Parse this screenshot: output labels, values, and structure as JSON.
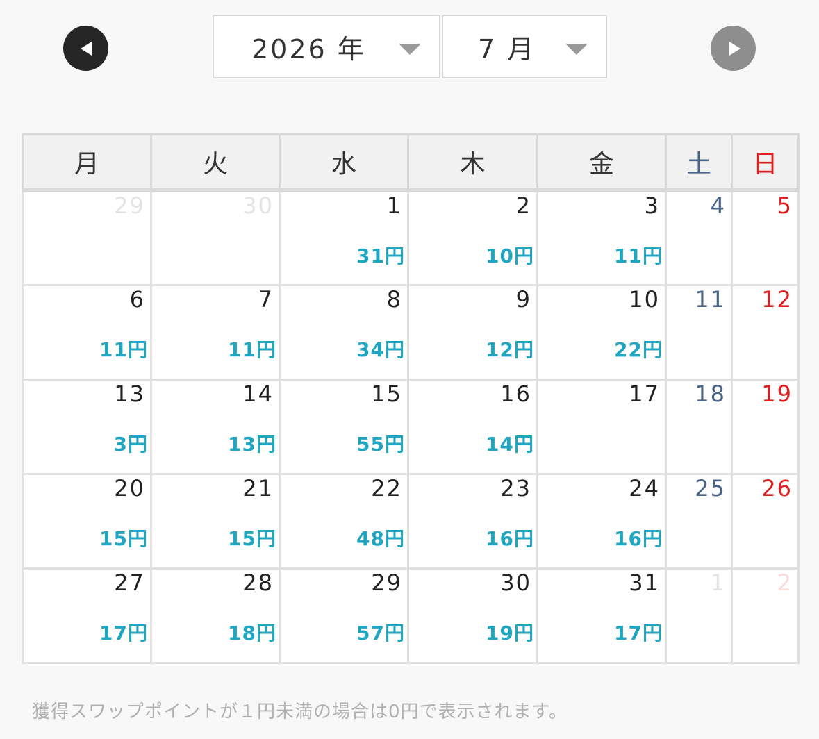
{
  "nav": {
    "prev_icon": "triangle-left-icon",
    "next_icon": "triangle-right-icon"
  },
  "year_select": {
    "value": "2026 年"
  },
  "month_select": {
    "value": "7 月"
  },
  "weekdays": [
    "月",
    "火",
    "水",
    "木",
    "金",
    "土",
    "日"
  ],
  "weeks": [
    [
      {
        "day": "29",
        "amount": "",
        "kind": "other"
      },
      {
        "day": "30",
        "amount": "",
        "kind": "other"
      },
      {
        "day": "1",
        "amount": "31円",
        "kind": "weekday"
      },
      {
        "day": "2",
        "amount": "10円",
        "kind": "weekday"
      },
      {
        "day": "3",
        "amount": "11円",
        "kind": "weekday"
      },
      {
        "day": "4",
        "amount": "",
        "kind": "sat"
      },
      {
        "day": "5",
        "amount": "",
        "kind": "sun"
      }
    ],
    [
      {
        "day": "6",
        "amount": "11円",
        "kind": "weekday"
      },
      {
        "day": "7",
        "amount": "11円",
        "kind": "weekday"
      },
      {
        "day": "8",
        "amount": "34円",
        "kind": "weekday"
      },
      {
        "day": "9",
        "amount": "12円",
        "kind": "weekday"
      },
      {
        "day": "10",
        "amount": "22円",
        "kind": "weekday"
      },
      {
        "day": "11",
        "amount": "",
        "kind": "sat"
      },
      {
        "day": "12",
        "amount": "",
        "kind": "sun"
      }
    ],
    [
      {
        "day": "13",
        "amount": "3円",
        "kind": "weekday"
      },
      {
        "day": "14",
        "amount": "13円",
        "kind": "weekday"
      },
      {
        "day": "15",
        "amount": "55円",
        "kind": "weekday"
      },
      {
        "day": "16",
        "amount": "14円",
        "kind": "weekday"
      },
      {
        "day": "17",
        "amount": "",
        "kind": "weekday"
      },
      {
        "day": "18",
        "amount": "",
        "kind": "sat"
      },
      {
        "day": "19",
        "amount": "",
        "kind": "sun"
      }
    ],
    [
      {
        "day": "20",
        "amount": "15円",
        "kind": "weekday"
      },
      {
        "day": "21",
        "amount": "15円",
        "kind": "weekday"
      },
      {
        "day": "22",
        "amount": "48円",
        "kind": "weekday"
      },
      {
        "day": "23",
        "amount": "16円",
        "kind": "weekday"
      },
      {
        "day": "24",
        "amount": "16円",
        "kind": "weekday"
      },
      {
        "day": "25",
        "amount": "",
        "kind": "sat"
      },
      {
        "day": "26",
        "amount": "",
        "kind": "sun"
      }
    ],
    [
      {
        "day": "27",
        "amount": "17円",
        "kind": "weekday"
      },
      {
        "day": "28",
        "amount": "18円",
        "kind": "weekday"
      },
      {
        "day": "29",
        "amount": "57円",
        "kind": "weekday"
      },
      {
        "day": "30",
        "amount": "19円",
        "kind": "weekday"
      },
      {
        "day": "31",
        "amount": "17円",
        "kind": "weekday"
      },
      {
        "day": "1",
        "amount": "",
        "kind": "other"
      },
      {
        "day": "2",
        "amount": "",
        "kind": "other-sun"
      }
    ]
  ],
  "note": "獲得スワップポイントが１円未満の場合は0円で表示されます。",
  "colors": {
    "amount": "#21a6c2",
    "saturday": "#4a6488",
    "sunday": "#e02020",
    "prev_button": "#262626",
    "next_button": "#8e8e8e"
  }
}
